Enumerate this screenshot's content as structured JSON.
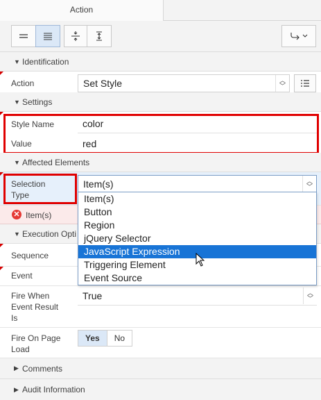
{
  "tabs": {
    "active": "Action"
  },
  "toolbar": {
    "icons": [
      "compact-view-icon",
      "expanded-view-icon",
      "collapse-all-icon",
      "expand-all-icon",
      "go-to-group-icon"
    ]
  },
  "sections": {
    "identification": "Identification",
    "settings": "Settings",
    "affected": "Affected Elements",
    "execution": "Execution Opti",
    "comments": "Comments",
    "audit": "Audit Information"
  },
  "identification": {
    "action_label": "Action",
    "action_value": "Set Style"
  },
  "settings": {
    "style_name_label": "Style Name",
    "style_name_value": "color",
    "value_label": "Value",
    "value_value": "red"
  },
  "affected": {
    "selection_type_label_1": "Selection",
    "selection_type_label_2": "Type",
    "selection_type_value": "Item(s)",
    "error_text": "Item(s)"
  },
  "dropdown": {
    "options": [
      "Item(s)",
      "Button",
      "Region",
      "jQuery Selector",
      "JavaScript Expression",
      "Triggering Element",
      "Event Source"
    ],
    "highlighted_index": 4
  },
  "execution": {
    "sequence_label": "Sequence",
    "event_label": "Event",
    "fire_when_label_1": "Fire When",
    "fire_when_label_2": "Event Result",
    "fire_when_label_3": "Is",
    "fire_when_value": "True",
    "fire_on_load_label_1": "Fire On Page",
    "fire_on_load_label_2": "Load",
    "yes": "Yes",
    "no": "No"
  },
  "colors": {
    "highlight": "#e00000",
    "selection": "#1874d6",
    "active_button": "#dbe8f7"
  }
}
